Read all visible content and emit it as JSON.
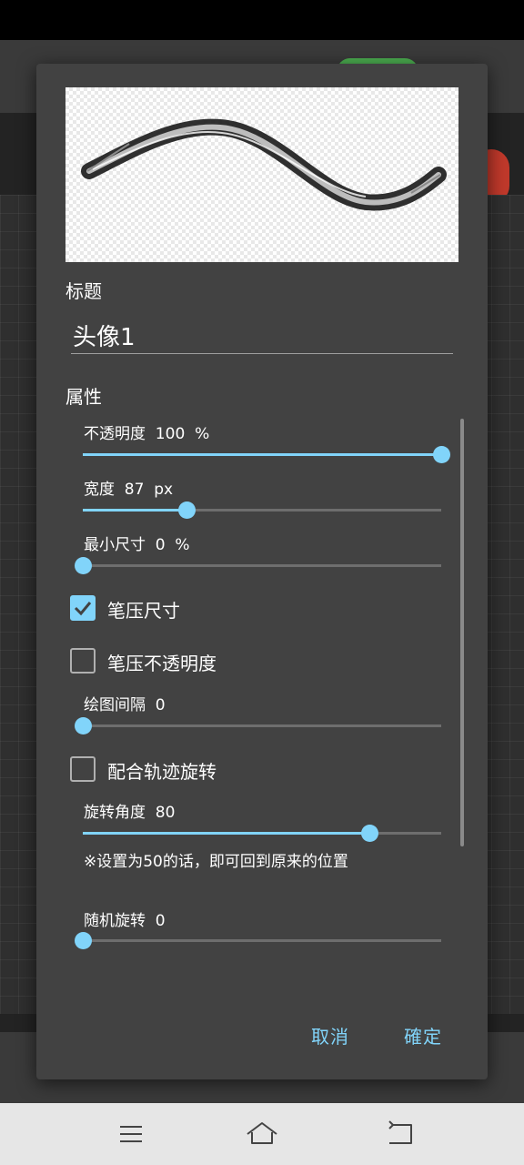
{
  "dialog": {
    "title_section_label": "标题",
    "title_value": "头像1",
    "properties_label": "属性",
    "sliders": [
      {
        "label": "不透明度  100  %",
        "value_fraction": 1.0
      },
      {
        "label": "宽度  87  px",
        "value_fraction": 0.29
      },
      {
        "label": "最小尺寸  0  %",
        "value_fraction": 0.0
      },
      {
        "label": "绘图间隔  0",
        "value_fraction": 0.0
      },
      {
        "label": "旋转角度  80",
        "value_fraction": 0.8
      },
      {
        "label": "随机旋转  0",
        "value_fraction": 0.0
      }
    ],
    "checkboxes": [
      {
        "label": "笔压尺寸",
        "checked": true
      },
      {
        "label": "笔压不透明度",
        "checked": false
      },
      {
        "label": "配合轨迹旋转",
        "checked": false
      }
    ],
    "rotation_note": "※设置为50的话，即可回到原来的位置",
    "cancel_label": "取消",
    "confirm_label": "確定"
  },
  "colors": {
    "accent": "#81d4fa",
    "dialog_bg": "#424242",
    "track": "#6e6e6e"
  },
  "nav": {
    "icons": [
      "menu-icon",
      "home-icon",
      "back-icon"
    ]
  }
}
